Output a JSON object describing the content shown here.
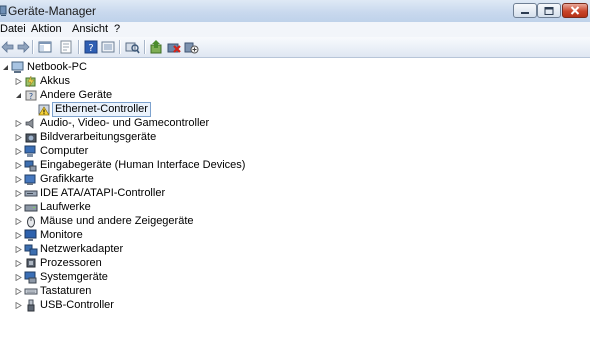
{
  "window": {
    "title": "Geräte-Manager"
  },
  "menu": {
    "items": [
      "Datei",
      "Aktion",
      "Ansicht",
      "?"
    ]
  },
  "toolbar": {
    "buttons": [
      {
        "icon": "back-arrow-icon"
      },
      {
        "icon": "forward-arrow-icon"
      },
      {
        "icon": "show-hide-console-tree-icon"
      },
      {
        "icon": "properties-icon"
      },
      {
        "icon": "help-icon"
      },
      {
        "icon": "show-hidden-icon"
      },
      {
        "icon": "scan-hardware-icon"
      },
      {
        "icon": "update-driver-icon"
      },
      {
        "icon": "uninstall-icon"
      },
      {
        "icon": "disable-device-icon"
      }
    ]
  },
  "tree": {
    "root": "Netbook-PC",
    "nodes": [
      {
        "label": "Akkus",
        "icon": "battery-icon",
        "state": "collapsed"
      },
      {
        "label": "Andere Geräte",
        "icon": "unknown-device-icon",
        "state": "expanded"
      },
      {
        "label": "Ethernet-Controller",
        "icon": "warning-device-icon",
        "state": "leaf",
        "selected": true
      },
      {
        "label": "Audio-, Video- und Gamecontroller",
        "icon": "speaker-icon",
        "state": "collapsed"
      },
      {
        "label": "Bildverarbeitungsgeräte",
        "icon": "camera-icon",
        "state": "collapsed"
      },
      {
        "label": "Computer",
        "icon": "computer-icon",
        "state": "collapsed"
      },
      {
        "label": "Eingabegeräte (Human Interface Devices)",
        "icon": "hid-icon",
        "state": "collapsed"
      },
      {
        "label": "Grafikkarte",
        "icon": "display-adapter-icon",
        "state": "collapsed"
      },
      {
        "label": "IDE ATA/ATAPI-Controller",
        "icon": "ide-controller-icon",
        "state": "collapsed"
      },
      {
        "label": "Laufwerke",
        "icon": "disk-drive-icon",
        "state": "collapsed"
      },
      {
        "label": "Mäuse und andere Zeigegeräte",
        "icon": "mouse-icon",
        "state": "collapsed"
      },
      {
        "label": "Monitore",
        "icon": "monitor-icon",
        "state": "collapsed"
      },
      {
        "label": "Netzwerkadapter",
        "icon": "network-adapter-icon",
        "state": "collapsed"
      },
      {
        "label": "Prozessoren",
        "icon": "processor-icon",
        "state": "collapsed"
      },
      {
        "label": "Systemgeräte",
        "icon": "system-devices-icon",
        "state": "collapsed"
      },
      {
        "label": "Tastaturen",
        "icon": "keyboard-icon",
        "state": "collapsed"
      },
      {
        "label": "USB-Controller",
        "icon": "usb-icon",
        "state": "collapsed"
      }
    ]
  }
}
